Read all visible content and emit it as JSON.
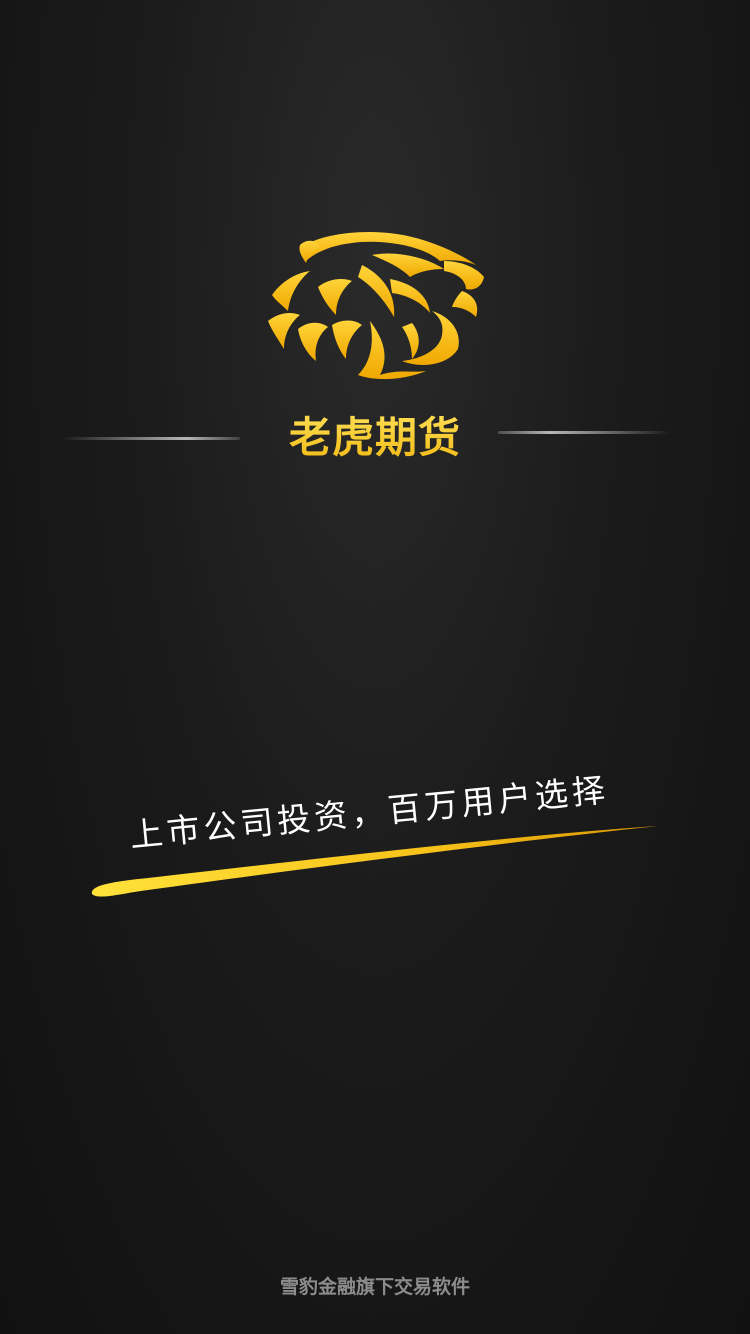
{
  "brand": {
    "logo_icon": "tiger-head-icon",
    "name": "老虎期货",
    "accent_color": "#f3c51d"
  },
  "slogan": {
    "text": "上市公司投资，百万用户选择",
    "swoosh_color": "#f5c518"
  },
  "footer": {
    "text": "雪豹金融旗下交易软件"
  }
}
